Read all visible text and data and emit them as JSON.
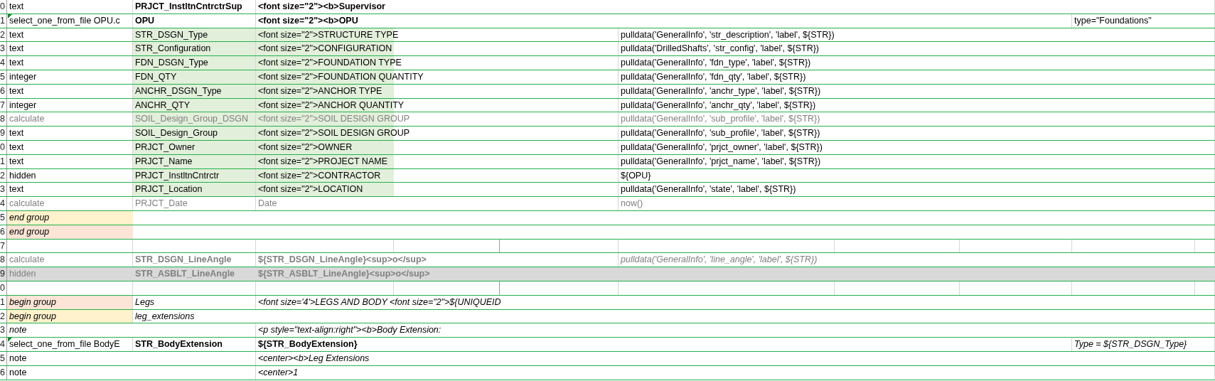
{
  "sheet": {
    "rows": [
      {
        "num": "0",
        "flag": false,
        "band": false,
        "cells": {
          "a": {
            "text": "text"
          },
          "b": {
            "text": "PRJCT_InstltnCntrctrSup",
            "bold": true
          },
          "c": {
            "text": "<font size=\"2\"><b>Supervisor",
            "bold": true
          }
        }
      },
      {
        "num": "1",
        "flag": true,
        "band": false,
        "cells": {
          "a": {
            "text": "select_one_from_file OPU.c"
          },
          "b": {
            "text": "OPU",
            "bold": true
          },
          "c": {
            "text": "<font size=\"2\"><b>OPU",
            "bold": true
          },
          "i": {
            "text": "type=\"Foundations\""
          }
        }
      },
      {
        "num": "2",
        "flag": false,
        "band": false,
        "cells": {
          "a": {
            "text": "text"
          },
          "b": {
            "text": "STR_DSGN_Type",
            "color": "#e2efda"
          },
          "c": {
            "text": "<font size=\"2\">STRUCTURE TYPE",
            "color": "#e2efda"
          },
          "f": {
            "text": "pulldata('GeneralInfo', 'str_description', 'label', ${STR})"
          }
        }
      },
      {
        "num": "3",
        "flag": false,
        "band": false,
        "cells": {
          "a": {
            "text": "text"
          },
          "b": {
            "text": "STR_Configuration",
            "color": "#e2efda"
          },
          "c": {
            "text": "<font size=\"2\">CONFIGURATION",
            "color": "#e2efda"
          },
          "f": {
            "text": "pulldata('DrilledShafts', 'str_config', 'label', ${STR})"
          }
        }
      },
      {
        "num": "4",
        "flag": false,
        "band": false,
        "cells": {
          "a": {
            "text": "text"
          },
          "b": {
            "text": "FDN_DSGN_Type",
            "color": "#e2efda"
          },
          "c": {
            "text": "<font size=\"2\">FOUNDATION TYPE",
            "color": "#e2efda"
          },
          "f": {
            "text": "pulldata('GeneralInfo', 'fdn_type', 'label', ${STR})"
          }
        }
      },
      {
        "num": "5",
        "flag": false,
        "band": false,
        "cells": {
          "a": {
            "text": "integer"
          },
          "b": {
            "text": "FDN_QTY",
            "color": "#e2efda"
          },
          "c": {
            "text": "<font size=\"2\">FOUNDATION QUANTITY",
            "color": "#e2efda"
          },
          "f": {
            "text": "pulldata('GeneralInfo', 'fdn_qty', 'label', ${STR})"
          }
        }
      },
      {
        "num": "6",
        "flag": false,
        "band": false,
        "cells": {
          "a": {
            "text": "text"
          },
          "b": {
            "text": "ANCHR_DSGN_Type",
            "color": "#e2efda"
          },
          "c": {
            "text": "<font size=\"2\">ANCHOR TYPE",
            "color": "#e2efda"
          },
          "f": {
            "text": "pulldata('GeneralInfo', 'anchr_type', 'label', ${STR})"
          }
        }
      },
      {
        "num": "7",
        "flag": false,
        "band": false,
        "cells": {
          "a": {
            "text": "integer"
          },
          "b": {
            "text": "ANCHR_QTY",
            "color": "#e2efda"
          },
          "c": {
            "text": "<font size=\"2\">ANCHOR QUANTITY",
            "color": "#e2efda"
          },
          "f": {
            "text": "pulldata('GeneralInfo', 'anchr_qty', 'label', ${STR})"
          }
        }
      },
      {
        "num": "8",
        "flag": false,
        "band": false,
        "cells": {
          "a": {
            "text": "calculate",
            "grey": true
          },
          "b": {
            "text": "SOIL_Design_Group_DSGN",
            "color": "#e2efda",
            "grey": true
          },
          "c": {
            "text": "<font size=\"2\">SOIL DESIGN GROUP",
            "color": "#e2efda",
            "grey": true
          },
          "f": {
            "text": "pulldata('GeneralInfo', 'sub_profile', 'label', ${STR})",
            "grey": true
          }
        }
      },
      {
        "num": "9",
        "flag": false,
        "band": false,
        "cells": {
          "a": {
            "text": "text"
          },
          "b": {
            "text": "SOIL_Design_Group",
            "color": "#e2efda"
          },
          "c": {
            "text": "<font size=\"2\">SOIL DESIGN GROUP",
            "color": "#e2efda"
          },
          "f": {
            "text": "pulldata('GeneralInfo', 'sub_profile', 'label', ${STR})"
          }
        }
      },
      {
        "num": "0",
        "flag": false,
        "band": false,
        "cells": {
          "a": {
            "text": "text"
          },
          "b": {
            "text": "PRJCT_Owner",
            "color": "#e2efda"
          },
          "c": {
            "text": "<font size=\"2\">OWNER",
            "color": "#e2efda"
          },
          "f": {
            "text": "pulldata('GeneralInfo', 'prjct_owner', 'label', ${STR})"
          }
        }
      },
      {
        "num": "1",
        "flag": false,
        "band": false,
        "cells": {
          "a": {
            "text": "text"
          },
          "b": {
            "text": "PRJCT_Name",
            "color": "#e2efda"
          },
          "c": {
            "text": "<font size=\"2\">PROJECT NAME",
            "color": "#e2efda"
          },
          "f": {
            "text": "pulldata('GeneralInfo', 'prjct_name', 'label', ${STR})"
          }
        }
      },
      {
        "num": "2",
        "flag": false,
        "band": false,
        "cells": {
          "a": {
            "text": "hidden"
          },
          "b": {
            "text": "PRJCT_InstltnCntrctr",
            "color": "#e2efda"
          },
          "c": {
            "text": "<font size=\"2\">CONTRACTOR",
            "color": "#e2efda"
          },
          "f": {
            "text": "${OPU}"
          }
        }
      },
      {
        "num": "3",
        "flag": false,
        "band": false,
        "cells": {
          "a": {
            "text": "text"
          },
          "b": {
            "text": "PRJCT_Location",
            "color": "#e2efda"
          },
          "c": {
            "text": "<font size=\"2\">LOCATION",
            "color": "#e2efda"
          },
          "f": {
            "text": "pulldata('GeneralInfo', 'state', 'label', ${STR})"
          }
        }
      },
      {
        "num": "4",
        "flag": false,
        "band": false,
        "cells": {
          "a": {
            "text": "calculate",
            "grey": true
          },
          "b": {
            "text": "PRJCT_Date",
            "grey": true
          },
          "c": {
            "text": "Date",
            "grey": true
          },
          "f": {
            "text": "now()",
            "grey": true
          }
        }
      },
      {
        "num": "5",
        "flag": false,
        "band": false,
        "cells": {
          "a": {
            "text": "end group",
            "italic": true,
            "color": "#fff2cc"
          }
        }
      },
      {
        "num": "6",
        "flag": false,
        "band": false,
        "cells": {
          "a": {
            "text": "end group",
            "italic": true,
            "color": "#fce4d6"
          }
        }
      },
      {
        "num": "7",
        "flag": false,
        "band": false
      },
      {
        "num": "8",
        "flag": false,
        "band": false,
        "cells": {
          "a": {
            "text": "calculate",
            "grey": true
          },
          "b": {
            "text": "STR_DSGN_LineAngle",
            "bold": true,
            "grey": true
          },
          "c": {
            "text": "${STR_DSGN_LineAngle}<sup>o</sup>",
            "bold": true,
            "grey": true
          },
          "f": {
            "text": "pulldata('GeneralInfo', 'line_angle', 'label', ${STR})",
            "italic": true,
            "grey": true
          }
        }
      },
      {
        "num": "9",
        "flag": false,
        "band": true,
        "cells": {
          "a": {
            "text": "hidden",
            "grey": true
          },
          "b": {
            "text": "STR_ASBLT_LineAngle",
            "bold": true,
            "grey": true
          },
          "c": {
            "text": "${STR_ASBLT_LineAngle}<sup>o</sup>",
            "bold": true,
            "grey": true
          }
        }
      },
      {
        "num": "0",
        "flag": false,
        "band": false
      },
      {
        "num": "1",
        "flag": false,
        "band": false,
        "cells": {
          "a": {
            "text": "begin group",
            "italic": true,
            "color": "#fce4d6"
          },
          "b": {
            "text": "Legs",
            "italic": true
          },
          "c": {
            "text": "<font size='4'>LEGS AND BODY <font size=\"2\">${UNIQUEID",
            "italic": true
          }
        }
      },
      {
        "num": "2",
        "flag": false,
        "band": false,
        "cells": {
          "a": {
            "text": "begin group",
            "italic": true,
            "color": "#fff2cc"
          },
          "b": {
            "text": "leg_extensions",
            "italic": true
          }
        }
      },
      {
        "num": "3",
        "flag": false,
        "band": false,
        "cells": {
          "a": {
            "text": "note",
            "italic": true
          },
          "c": {
            "text": "<p style=\"text-align:right\"><b>Body Extension:",
            "italic": true
          }
        }
      },
      {
        "num": "4",
        "flag": true,
        "band": false,
        "cells": {
          "a": {
            "text": "select_one_from_file BodyE"
          },
          "b": {
            "text": "STR_BodyExtension",
            "bold": true
          },
          "c": {
            "text": "${STR_BodyExtension}",
            "bold": true
          },
          "i": {
            "text": "Type = ${STR_DSGN_Type}",
            "italic": true
          }
        }
      },
      {
        "num": "5",
        "flag": false,
        "band": false,
        "cells": {
          "a": {
            "text": "note"
          },
          "c": {
            "text": "<center><b>Leg Extensions",
            "italic": true
          }
        }
      },
      {
        "num": "6",
        "flag": false,
        "band": false,
        "cells": {
          "a": {
            "text": "note"
          },
          "c": {
            "text": "<center>1",
            "italic": true
          }
        }
      }
    ]
  }
}
